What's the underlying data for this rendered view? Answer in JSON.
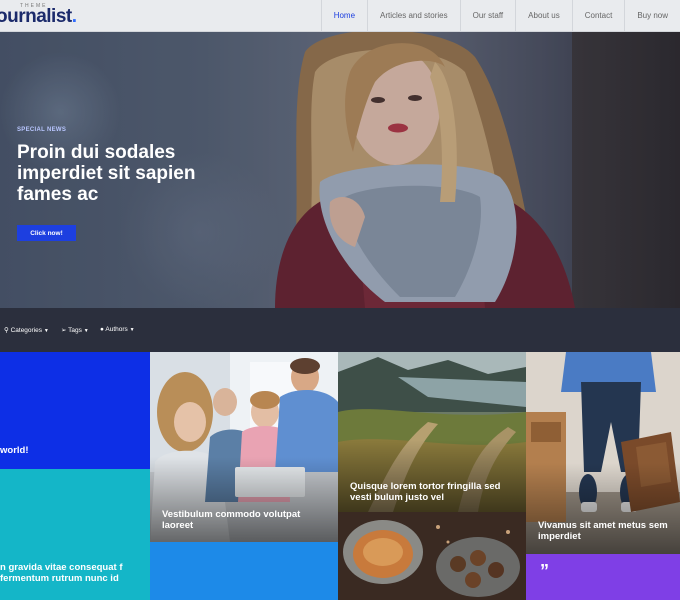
{
  "header": {
    "logo_tagline": "THEME",
    "logo_text": "ournalist",
    "logo_dot": ".",
    "nav": [
      {
        "label": "Home",
        "active": true
      },
      {
        "label": "Articles and stories"
      },
      {
        "label": "Our staff"
      },
      {
        "label": "About us"
      },
      {
        "label": "Contact"
      },
      {
        "label": "Buy now"
      }
    ]
  },
  "hero": {
    "label": "SPECIAL NEWS",
    "title": "Proin dui sodales imperdiet sit sapien fames ac",
    "button": "Click now!"
  },
  "filters": [
    {
      "label": "Categories",
      "icon": "tag-icon"
    },
    {
      "label": "Tags",
      "icon": "label-icon"
    },
    {
      "label": "Authors",
      "icon": "person-icon"
    }
  ],
  "tiles": {
    "t1": "world!",
    "t2": "n gravida vitae consequat f fermentum rutrum nunc id",
    "t3": "Vestibulum commodo volutpat laoreet",
    "t5": "Quisque lorem tortor fringilla sed vesti bulum justo vel",
    "t7": "Vivamus sit amet metus sem imperdiet",
    "t8_quote": "”"
  },
  "colors": {
    "accent": "#1d3fe0",
    "tile_blue": "#0d2fe6",
    "tile_cyan": "#14b6c8",
    "tile_sky": "#1d8ae8",
    "tile_purple": "#7f3fe6",
    "dark_bar": "#2b2f3d"
  }
}
